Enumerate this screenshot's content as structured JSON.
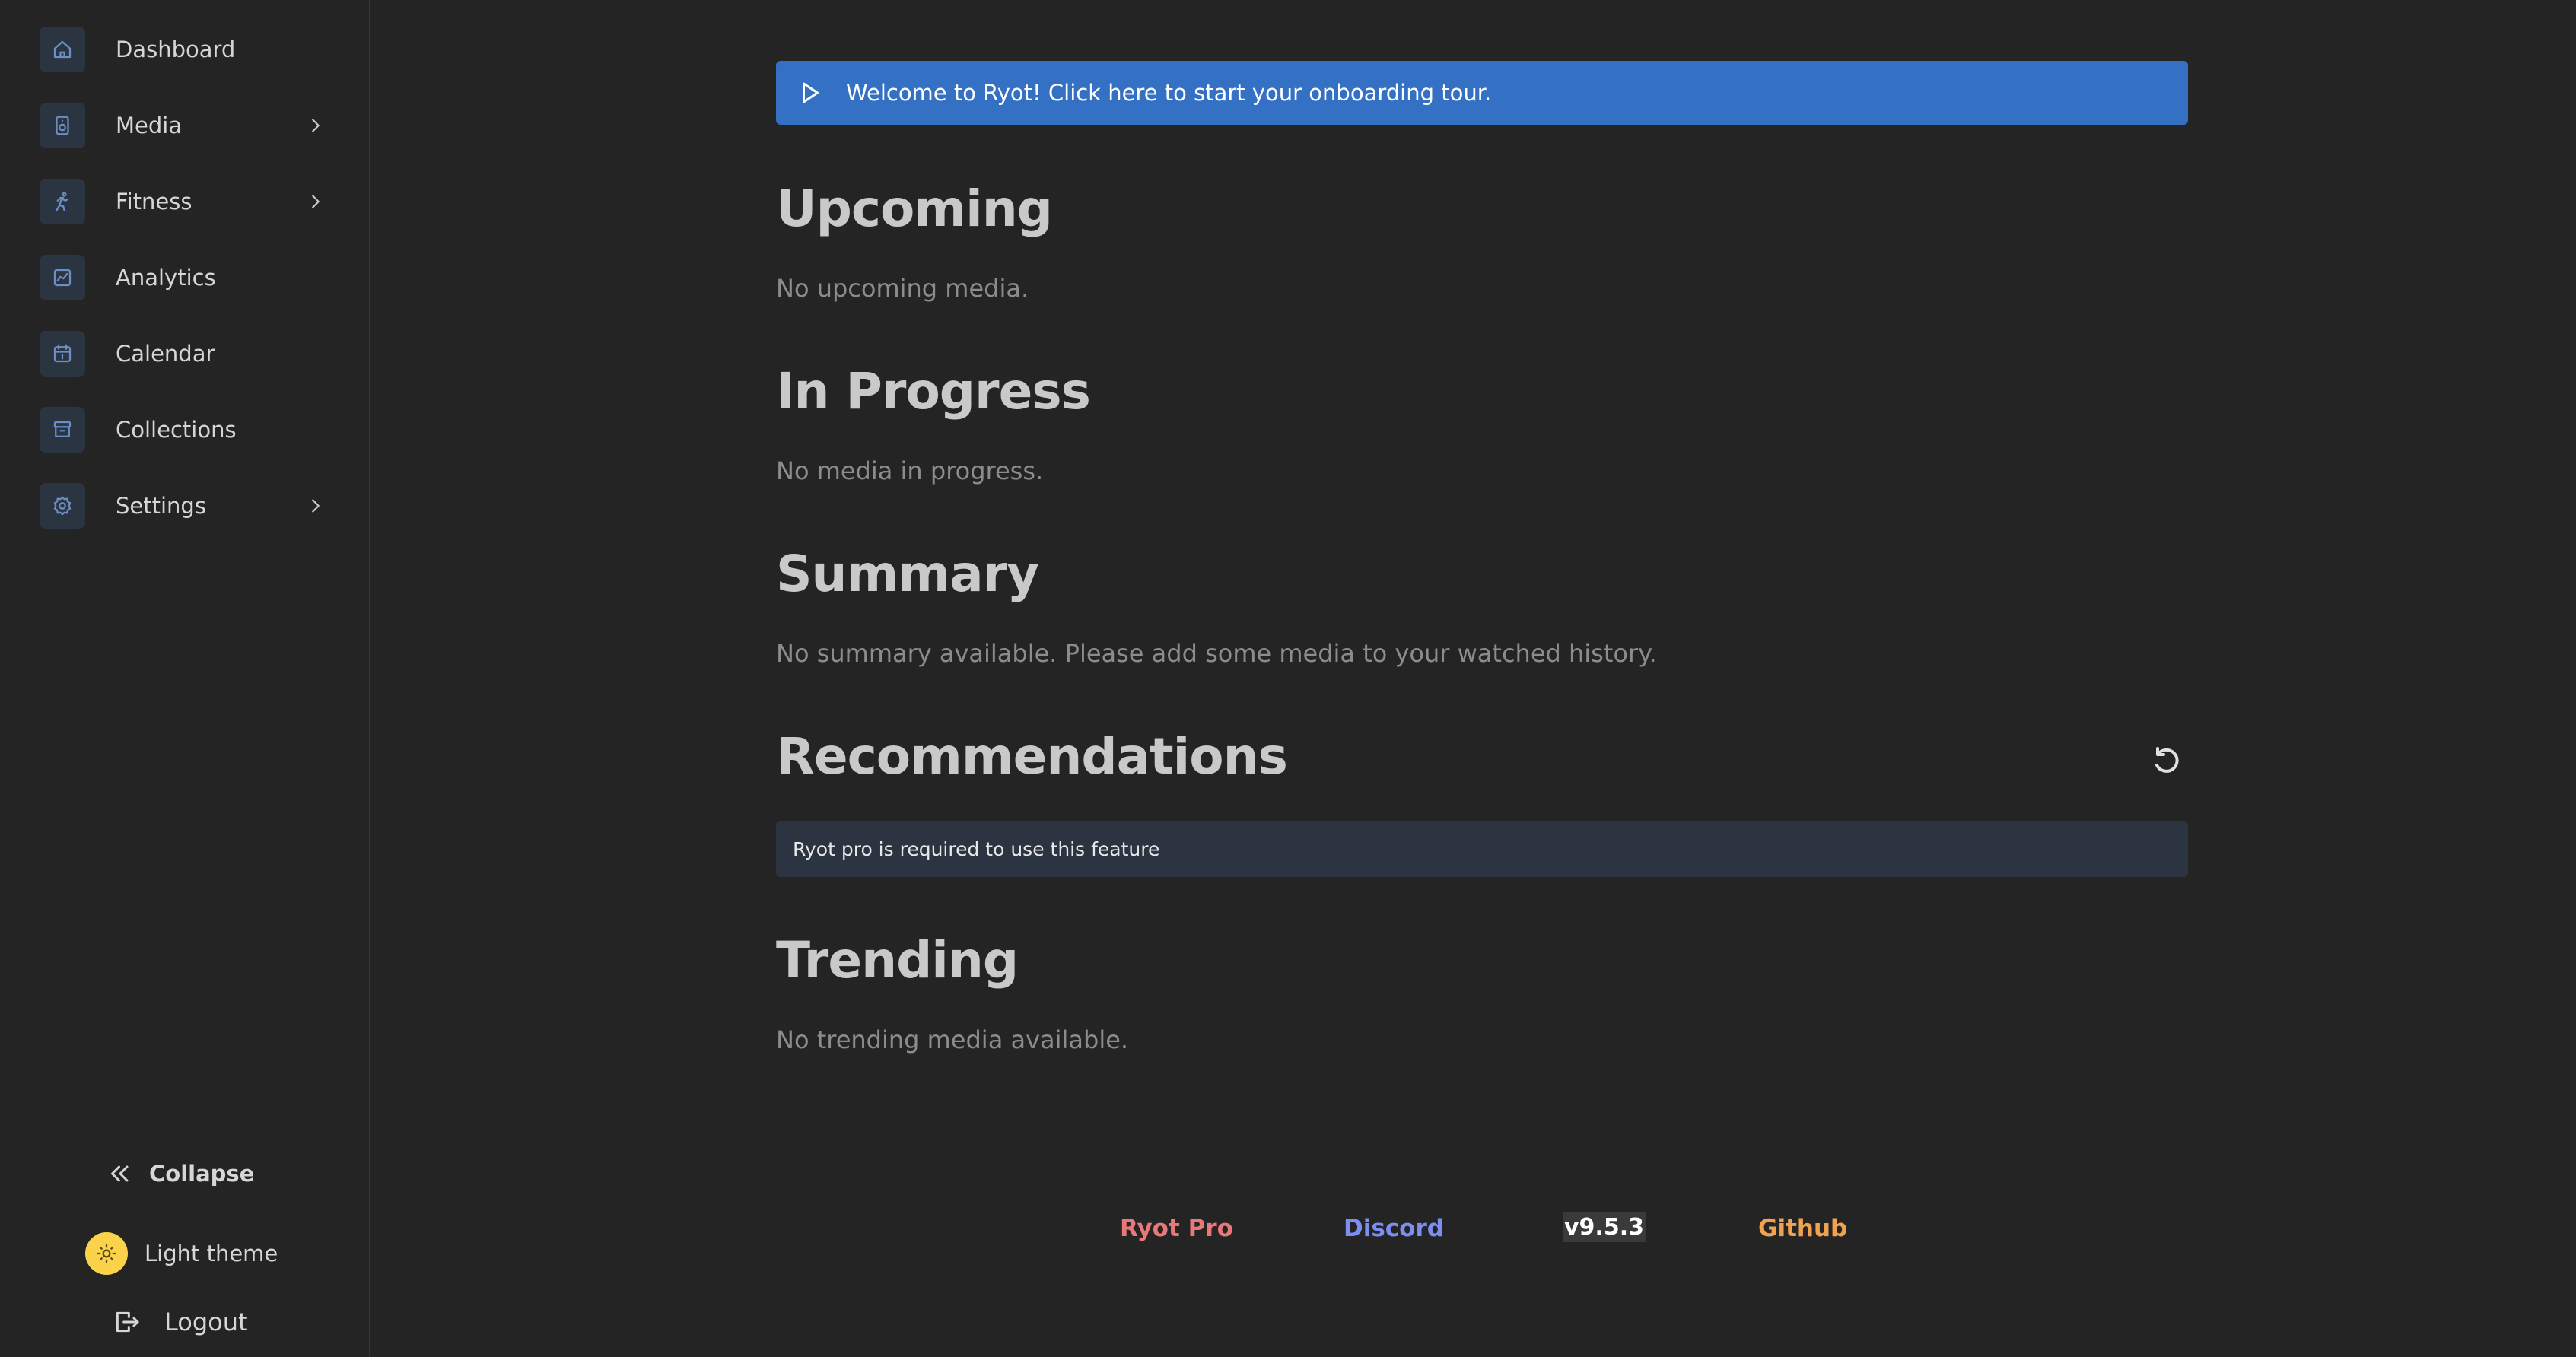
{
  "sidebar": {
    "items": [
      {
        "label": "Dashboard",
        "icon": "home-icon",
        "has_chevron": false
      },
      {
        "label": "Media",
        "icon": "media-icon",
        "has_chevron": true
      },
      {
        "label": "Fitness",
        "icon": "running-icon",
        "has_chevron": true
      },
      {
        "label": "Analytics",
        "icon": "chart-icon",
        "has_chevron": false
      },
      {
        "label": "Calendar",
        "icon": "calendar-icon",
        "has_chevron": false
      },
      {
        "label": "Collections",
        "icon": "archive-icon",
        "has_chevron": false
      },
      {
        "label": "Settings",
        "icon": "gear-icon",
        "has_chevron": true
      }
    ],
    "collapse_label": "Collapse",
    "theme_label": "Light theme",
    "logout_label": "Logout"
  },
  "banner": {
    "text": "Welcome to Ryot! Click here to start your onboarding tour."
  },
  "sections": {
    "upcoming": {
      "title": "Upcoming",
      "empty_text": "No upcoming media."
    },
    "in_progress": {
      "title": "In Progress",
      "empty_text": "No media in progress."
    },
    "summary": {
      "title": "Summary",
      "empty_text": "No summary available. Please add some media to your watched history."
    },
    "recommendations": {
      "title": "Recommendations",
      "notice": "Ryot pro is required to use this feature"
    },
    "trending": {
      "title": "Trending",
      "empty_text": "No trending media available."
    }
  },
  "footer": {
    "ryot_pro": "Ryot Pro",
    "discord": "Discord",
    "version": "v9.5.3",
    "github": "Github"
  },
  "colors": {
    "background": "#242424",
    "banner": "#3470c4",
    "ryot_pro": "#e8787a",
    "discord": "#7c8ff0",
    "github": "#f0a24f",
    "theme_toggle": "#fbd34b"
  }
}
